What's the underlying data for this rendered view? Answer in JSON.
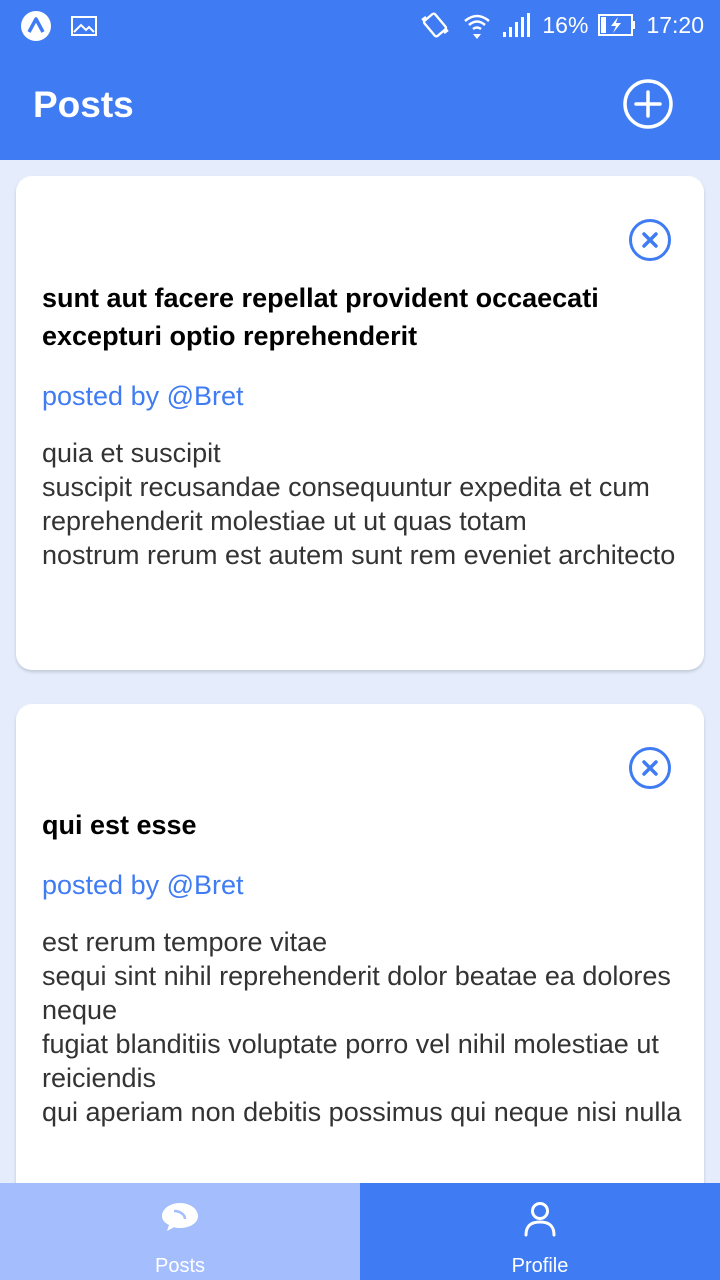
{
  "status_bar": {
    "battery": "16%",
    "time": "17:20"
  },
  "header": {
    "title": "Posts"
  },
  "posts": [
    {
      "title": "sunt aut facere repellat provident occaecati excepturi optio reprehenderit",
      "author": "posted by @Bret",
      "body": "quia et suscipit\nsuscipit recusandae consequuntur expedita et cum\nreprehenderit molestiae ut ut quas totam\nnostrum rerum est autem sunt rem eveniet architecto"
    },
    {
      "title": "qui est esse",
      "author": "posted by @Bret",
      "body": "est rerum tempore vitae\nsequi sint nihil reprehenderit dolor beatae ea dolores neque\nfugiat blanditiis voluptate porro vel nihil molestiae ut reiciendis\nqui aperiam non debitis possimus qui neque nisi nulla"
    }
  ],
  "tabs": [
    {
      "label": "Posts",
      "icon": "chat-bubbles-icon",
      "active": true
    },
    {
      "label": "Profile",
      "icon": "person-icon",
      "active": false
    }
  ],
  "colors": {
    "primary": "#3f7bf2",
    "active_tab": "#a3bdfd",
    "background": "#e5edfd",
    "author_text": "#3f7bf2"
  }
}
